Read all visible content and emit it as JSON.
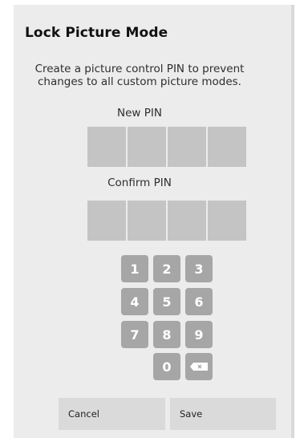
{
  "dialog": {
    "title": "Lock Picture Mode",
    "description": "Create a picture control PIN to prevent changes to all custom picture modes.",
    "new_pin_label": "New PIN",
    "confirm_pin_label": "Confirm PIN"
  },
  "keypad": {
    "keys": [
      "1",
      "2",
      "3",
      "4",
      "5",
      "6",
      "7",
      "8",
      "9",
      "0"
    ],
    "backspace_icon": "backspace-icon"
  },
  "buttons": {
    "cancel_label": "Cancel",
    "save_label": "Save"
  },
  "colors": {
    "panel_background": "#ececec",
    "pin_box": "#c4c4c4",
    "key_background": "#a6a6a6",
    "button_background": "#dadada"
  }
}
